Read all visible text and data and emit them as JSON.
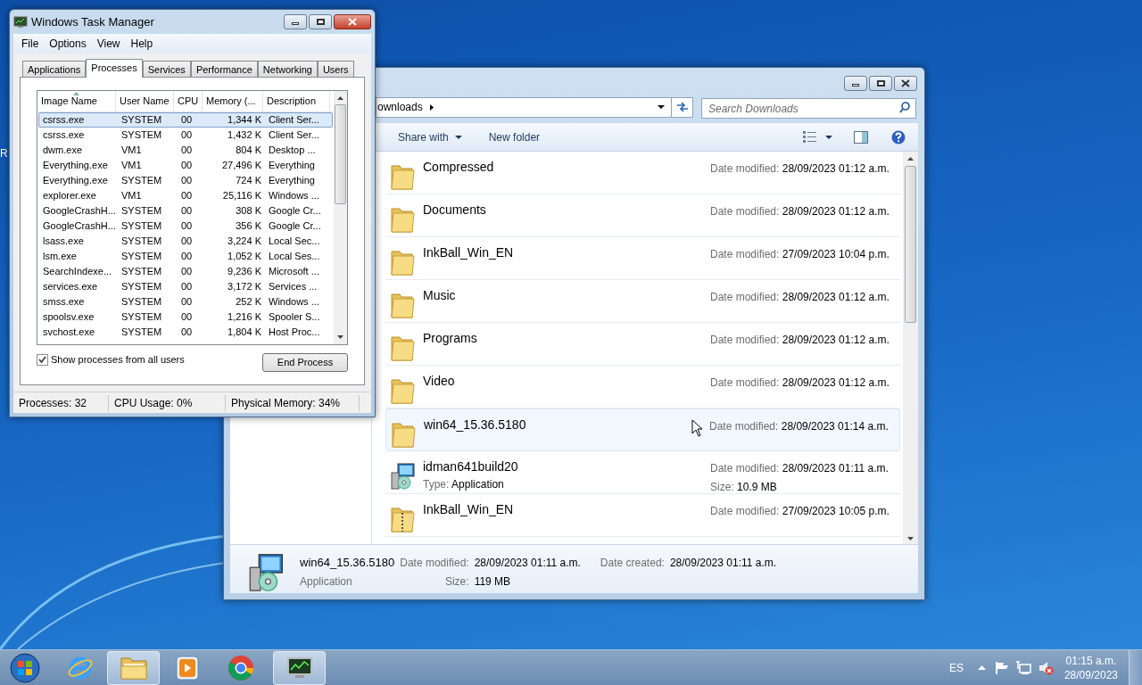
{
  "desktop": {
    "labels": [
      "R"
    ]
  },
  "task_manager": {
    "title": "Windows Task Manager",
    "menu": [
      "File",
      "Options",
      "View",
      "Help"
    ],
    "tabs": [
      {
        "label": "Applications",
        "selected": false
      },
      {
        "label": "Processes",
        "selected": true
      },
      {
        "label": "Services",
        "selected": false
      },
      {
        "label": "Performance",
        "selected": false
      },
      {
        "label": "Networking",
        "selected": false
      },
      {
        "label": "Users",
        "selected": false
      }
    ],
    "columns": [
      "Image Name",
      "User Name",
      "CPU",
      "Memory (...",
      "Description"
    ],
    "rows": [
      {
        "cells": [
          "csrss.exe",
          "SYSTEM",
          "00",
          "1,344 K",
          "Client Ser..."
        ],
        "selected": true
      },
      {
        "cells": [
          "csrss.exe",
          "SYSTEM",
          "00",
          "1,432 K",
          "Client Ser..."
        ],
        "selected": false
      },
      {
        "cells": [
          "dwm.exe",
          "VM1",
          "00",
          "804 K",
          "Desktop ..."
        ],
        "selected": false
      },
      {
        "cells": [
          "Everything.exe",
          "VM1",
          "00",
          "27,496 K",
          "Everything"
        ],
        "selected": false
      },
      {
        "cells": [
          "Everything.exe",
          "SYSTEM",
          "00",
          "724 K",
          "Everything"
        ],
        "selected": false
      },
      {
        "cells": [
          "explorer.exe",
          "VM1",
          "00",
          "25,116 K",
          "Windows ..."
        ],
        "selected": false
      },
      {
        "cells": [
          "GoogleCrashH...",
          "SYSTEM",
          "00",
          "308 K",
          "Google Cr..."
        ],
        "selected": false
      },
      {
        "cells": [
          "GoogleCrashH...",
          "SYSTEM",
          "00",
          "356 K",
          "Google Cr..."
        ],
        "selected": false
      },
      {
        "cells": [
          "lsass.exe",
          "SYSTEM",
          "00",
          "3,224 K",
          "Local Sec..."
        ],
        "selected": false
      },
      {
        "cells": [
          "lsm.exe",
          "SYSTEM",
          "00",
          "1,052 K",
          "Local Ses..."
        ],
        "selected": false
      },
      {
        "cells": [
          "SearchIndexe...",
          "SYSTEM",
          "00",
          "9,236 K",
          "Microsoft ..."
        ],
        "selected": false
      },
      {
        "cells": [
          "services.exe",
          "SYSTEM",
          "00",
          "3,172 K",
          "Services ..."
        ],
        "selected": false
      },
      {
        "cells": [
          "smss.exe",
          "SYSTEM",
          "00",
          "252 K",
          "Windows ..."
        ],
        "selected": false
      },
      {
        "cells": [
          "spoolsv.exe",
          "SYSTEM",
          "00",
          "1,216 K",
          "Spooler S..."
        ],
        "selected": false
      },
      {
        "cells": [
          "svchost.exe",
          "SYSTEM",
          "00",
          "1,804 K",
          "Host Proc..."
        ],
        "selected": false
      }
    ],
    "show_all_users": {
      "label": "Show processes from all users",
      "checked": true
    },
    "end_button": "End Process",
    "status": [
      "Processes: 32",
      "CPU Usage: 0%",
      "Physical Memory: 34%"
    ]
  },
  "explorer": {
    "address": "ownloads",
    "search": {
      "placeholder": "Search Downloads"
    },
    "toolbar": [
      "Share with",
      "New folder"
    ],
    "items": [
      {
        "kind": "folder",
        "name": "Compressed",
        "date_label": "Date modified:",
        "date": "28/09/2023 01:12 a.m.",
        "selected": false
      },
      {
        "kind": "folder",
        "name": "Documents",
        "date_label": "Date modified:",
        "date": "28/09/2023 01:12 a.m.",
        "selected": false
      },
      {
        "kind": "folder",
        "name": "InkBall_Win_EN",
        "date_label": "Date modified:",
        "date": "27/09/2023 10:04 p.m.",
        "selected": false
      },
      {
        "kind": "folder",
        "name": "Music",
        "date_label": "Date modified:",
        "date": "28/09/2023 01:12 a.m.",
        "selected": false
      },
      {
        "kind": "folder",
        "name": "Programs",
        "date_label": "Date modified:",
        "date": "28/09/2023 01:12 a.m.",
        "selected": false
      },
      {
        "kind": "folder",
        "name": "Video",
        "date_label": "Date modified:",
        "date": "28/09/2023 01:12 a.m.",
        "selected": false
      },
      {
        "kind": "folder",
        "name": "win64_15.36.5180",
        "date_label": "Date modified:",
        "date": "28/09/2023 01:14 a.m.",
        "selected": true
      },
      {
        "kind": "app",
        "name": "idman641build20",
        "date_label": "Date modified:",
        "date": "28/09/2023 01:11 a.m.",
        "type_label": "Type:",
        "type": "Application",
        "size_label": "Size:",
        "size": "10.9 MB",
        "selected": false
      },
      {
        "kind": "zip",
        "name": "InkBall_Win_EN",
        "date_label": "Date modified:",
        "date": "27/09/2023 10:05 p.m.",
        "selected": false
      }
    ],
    "details": {
      "name": "win64_15.36.5180",
      "type": "Application",
      "modified_label": "Date modified:",
      "modified": "28/09/2023 01:11 a.m.",
      "size_label": "Size:",
      "size": "119 MB",
      "created_label": "Date created:",
      "created": "28/09/2023 01:11 a.m."
    }
  },
  "taskbar": {
    "apps": [
      {
        "kind": "ie",
        "active": false
      },
      {
        "kind": "explorer",
        "active": true
      },
      {
        "kind": "media",
        "active": false
      },
      {
        "kind": "chrome",
        "active": false
      },
      {
        "kind": "taskmgr",
        "active": true
      }
    ],
    "language": "ES",
    "time": "01:15 a.m.",
    "date": "28/09/2023"
  }
}
